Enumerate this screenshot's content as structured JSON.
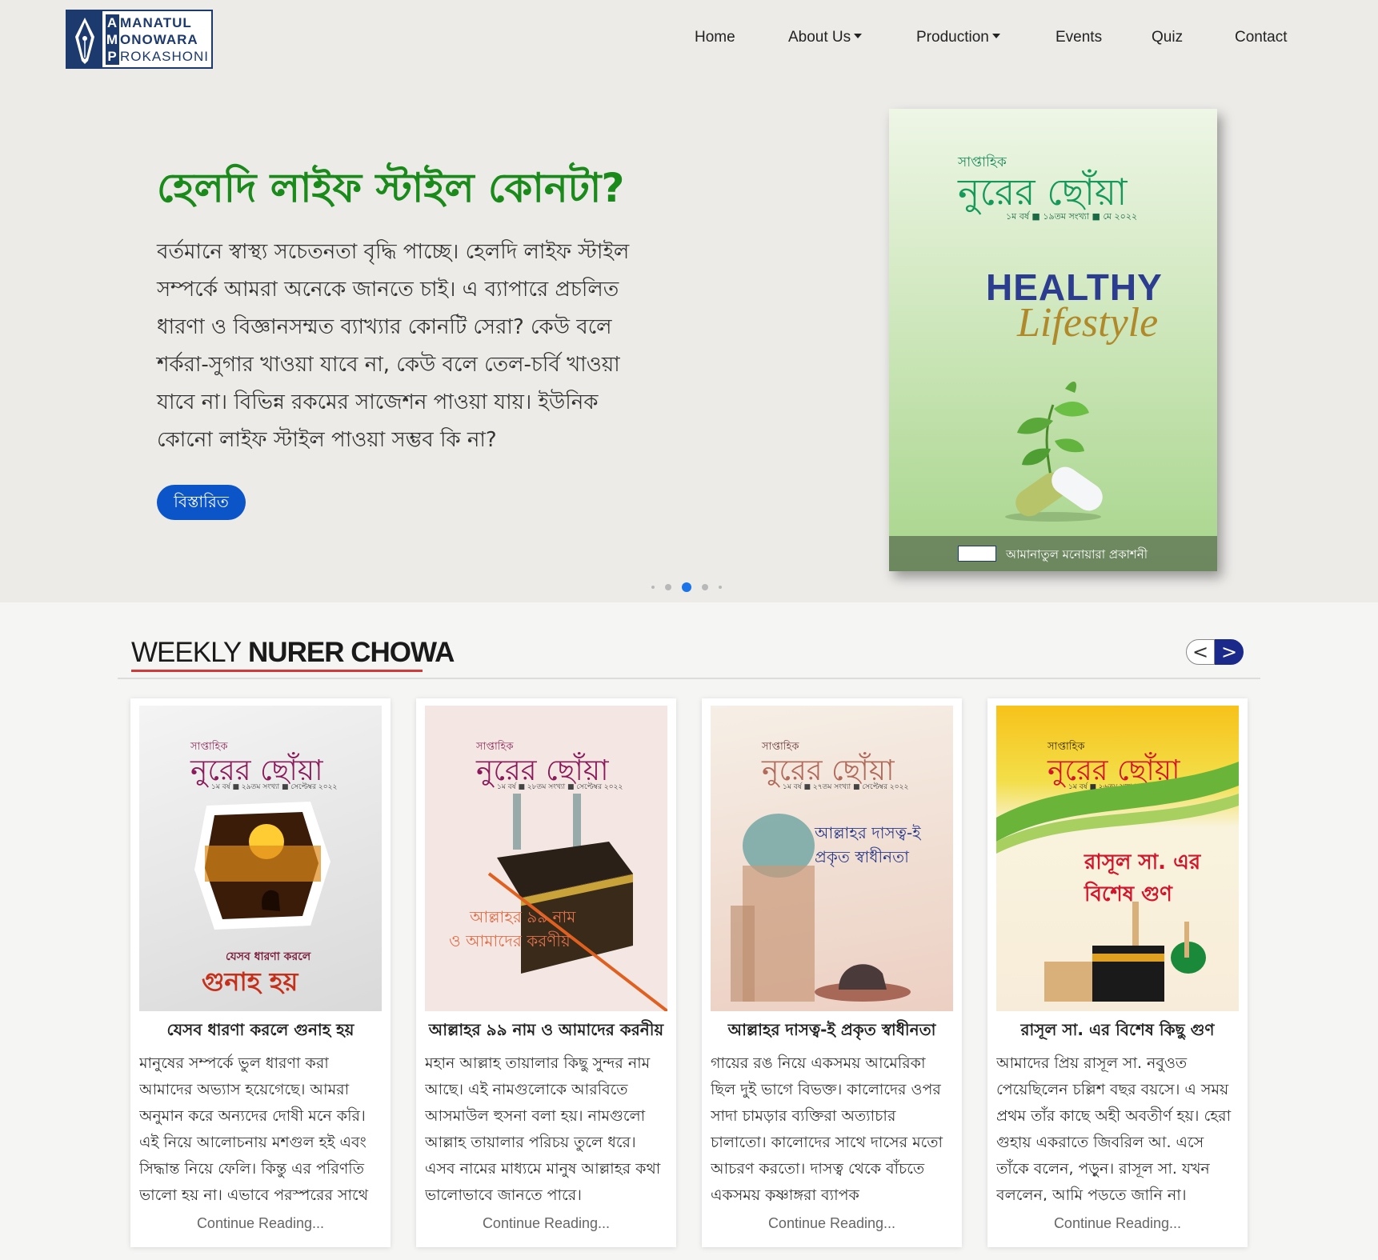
{
  "logo": {
    "line1_initial": "A",
    "line1_rest": "MANATUL",
    "line2_initial": "M",
    "line2_rest": "ONOWARA",
    "line3_initial": "P",
    "line3_rest": "ROKASHONI"
  },
  "nav": {
    "home": "Home",
    "about": "About Us",
    "production": "Production",
    "events": "Events",
    "quiz": "Quiz",
    "contact": "Contact"
  },
  "hero": {
    "title": "হেলদি লাইফ স্টাইল কোনটা?",
    "description": "বর্তমানে স্বাস্থ্য সচেতনতা বৃদ্ধি পাচ্ছে। হেলদি লাইফ স্টাইল সম্পর্কে আমরা অনেকে জানতে চাই। এ ব্যাপারে প্রচলিত ধারণা ও বিজ্ঞানসম্মত ব্যাখ্যার কোনটি সেরা? কেউ বলে শর্করা-সুগার খাওয়া যাবে না, কেউ বলে তেল-চর্বি খাওয়া যাবে না। বিভিন্ন রকমের সাজেশন পাওয়া যায়। ইউনিক কোনো লাইফ স্টাইল পাওয়া সম্ভব কি না?",
    "button": "বিস্তারিত",
    "cover": {
      "small": "সাপ্তাহিক",
      "name": "নুরের ছোঁয়া",
      "issue": "১ম বর্ষ ■ ১৯তম সংখ্যা ■ মে ২০২২",
      "headline1": "HEALTHY",
      "headline2": "Lifestyle",
      "publisher": "আমানাতুল মনোয়ারা প্রকাশনী"
    },
    "carousel": {
      "active_index": 2,
      "total": 5
    }
  },
  "section": {
    "title_light": "WEEKLY",
    "title_bold": "NURER CHOWA"
  },
  "arrows": {
    "prev": "<",
    "next": ">"
  },
  "cards": [
    {
      "cover_small": "সাপ্তাহিক",
      "cover_name": "নুরের ছোঁয়া",
      "cover_issue": "১ম বর্ষ ■ ২৯তম সংখ্যা ■ সেপ্টেম্বর ২০২২",
      "cover_caption_small": "যেসব ধারণা করলে",
      "cover_caption_big": "গুনাহ হয়",
      "title": "যেসব ধারণা করলে গুনাহ হয়",
      "text": "মানুষের সম্পর্কে ভুল ধারণা করা আমাদের অভ্যাস হয়েগেছে। আমরা অনুমান করে অন্যদের দোষী মনে করি। এই নিয়ে আলোচনায় মশগুল হই এবং সিদ্ধান্ত নিয়ে ফেলি। কিন্তু এর পরিণতি ভালো হয় না। এভাবে পরস্পরের সাথে",
      "more": "Continue Reading..."
    },
    {
      "cover_small": "সাপ্তাহিক",
      "cover_name": "নুরের ছোঁয়া",
      "cover_issue": "১ম বর্ষ ■ ২৮তম সংখ্যা ■ সেপ্টেম্বর ২০২২",
      "cover_caption_small": "আল্লাহর ৯৯ নাম",
      "cover_caption_big": "ও আমাদের করণীয়",
      "title": "আল্লাহর ৯৯ নাম ও আমাদের করনীয়",
      "text": "মহান আল্লাহ তায়ালার কিছু সুন্দর নাম আছে। এই নামগুলোকে আরবিতে আসমাউল হুসনা বলা হয়। নামগুলো আল্লাহ তায়ালার পরিচয় তুলে ধরে। এসব নামের মাধ্যমে মানুষ আল্লাহর কথা ভালোভাবে জানতে পারে।",
      "more": "Continue Reading..."
    },
    {
      "cover_small": "সাপ্তাহিক",
      "cover_name": "নুরের ছোঁয়া",
      "cover_issue": "১ম বর্ষ ■ ২৭তম সংখ্যা ■ সেপ্টেম্বর ২০২২",
      "cover_caption_small": "আল্লাহর দাসত্ব-ই",
      "cover_caption_big": "প্রকৃত স্বাধীনতা",
      "title": "আল্লাহর দাসত্ব-ই প্রকৃত স্বাধীনতা",
      "text": "গায়ের রঙ নিয়ে একসময় আমেরিকা ছিল দুই ভাগে বিভক্ত। কালোদের ওপর সাদা চামড়ার ব্যক্তিরা অত্যাচার চালাতো। কালোদের সাথে দাসের মতো আচরণ করতো। দাসত্ব থেকে বাঁচতে একসময় কৃষ্ণাঙ্গরা ব্যাপক",
      "more": "Continue Reading..."
    },
    {
      "cover_small": "সাপ্তাহিক",
      "cover_name": "নুরের ছোঁয়া",
      "cover_issue": "১ম বর্ষ ■ ২৬তম সংখ্যা ■ সেপ্টেম্বর ২০২২",
      "cover_caption_small": "রাসূল সা. এর",
      "cover_caption_big": "বিশেষ গুণ",
      "title": "রাসূল সা. এর বিশেষ কিছু গুণ",
      "text": "আমাদের প্রিয় রাসূল সা. নবুওত পেয়েছিলেন চল্লিশ বছর বয়সে। এ সময় প্রথম তাঁর কাছে অহী অবতীর্ণ হয়। হেরা গুহায় একরাতে জিবরিল আ. এসে তাঁকে বলেন, পড়ুন। রাসূল সা. যখন বললেন, আমি পড়তে জানি না।",
      "more": "Continue Reading..."
    }
  ],
  "colors": {
    "brand_navy": "#1d3a6e",
    "hero_title_green": "#1a8a1a",
    "button_blue": "#0b55c9",
    "underline_red": "#d23a3a",
    "arrow_navy": "#1b2a8a"
  }
}
